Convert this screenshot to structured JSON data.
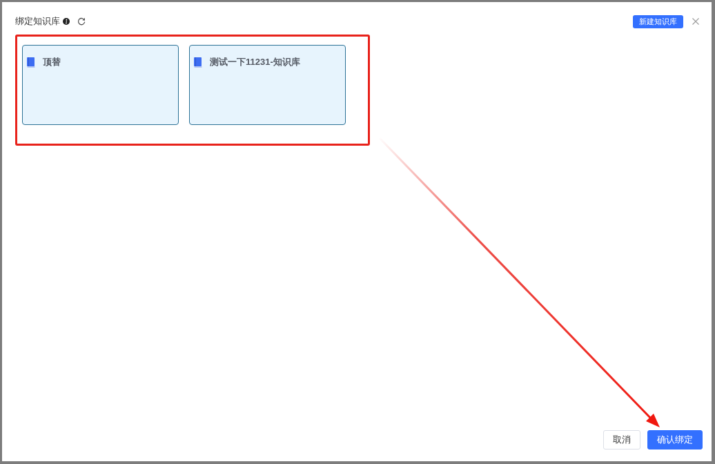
{
  "dialog": {
    "title": "绑定知识库",
    "new_button": {
      "label": "新建知识库"
    },
    "knowledge_bases": [
      {
        "name": "顶替"
      },
      {
        "name": "测试一下11231-知识库"
      }
    ],
    "footer_buttons": [
      {
        "label": "取消",
        "kind": "secondary"
      },
      {
        "label": "确认绑定",
        "kind": "primary"
      }
    ]
  }
}
